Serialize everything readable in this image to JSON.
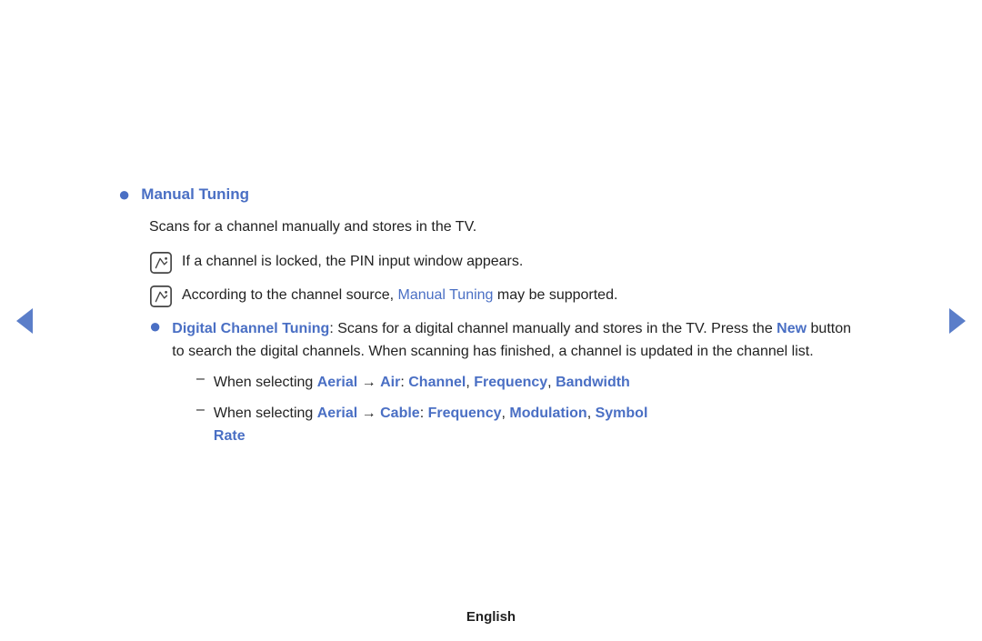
{
  "page": {
    "footer_label": "English"
  },
  "nav": {
    "left_arrow_label": "previous page",
    "right_arrow_label": "next page"
  },
  "content": {
    "main_bullet": {
      "label": "Manual Tuning",
      "description": "Scans for a channel manually and stores in the TV."
    },
    "note1": {
      "text": "If a channel is locked, the PIN input window appears."
    },
    "note2": {
      "text_before": "According to the channel source, ",
      "link": "Manual Tuning",
      "text_after": " may be supported."
    },
    "sub_bullet": {
      "label": "Digital Channel Tuning",
      "colon": ":",
      "text": " Scans for a digital channel manually and stores in the TV. Press the ",
      "new_label": "New",
      "text2": " button to search the digital channels. When scanning has finished, a channel is updated in the channel list."
    },
    "dash1": {
      "text_before": "When selecting ",
      "aerial_label": "Aerial",
      "arrow": " → ",
      "air_label": "Air",
      "colon": ": ",
      "channel_label": "Channel",
      "comma1": ", ",
      "frequency_label": "Frequency",
      "comma2": ", ",
      "bandwidth_label": "Bandwidth"
    },
    "dash2": {
      "text_before": "When selecting ",
      "aerial_label": "Aerial",
      "arrow": " → ",
      "cable_label": "Cable",
      "colon": ": ",
      "frequency_label": "Frequency",
      "comma1": ", ",
      "modulation_label": "Modulation",
      "comma2": ", ",
      "symbol_label": "Symbol",
      "rate_label": "Rate"
    }
  }
}
